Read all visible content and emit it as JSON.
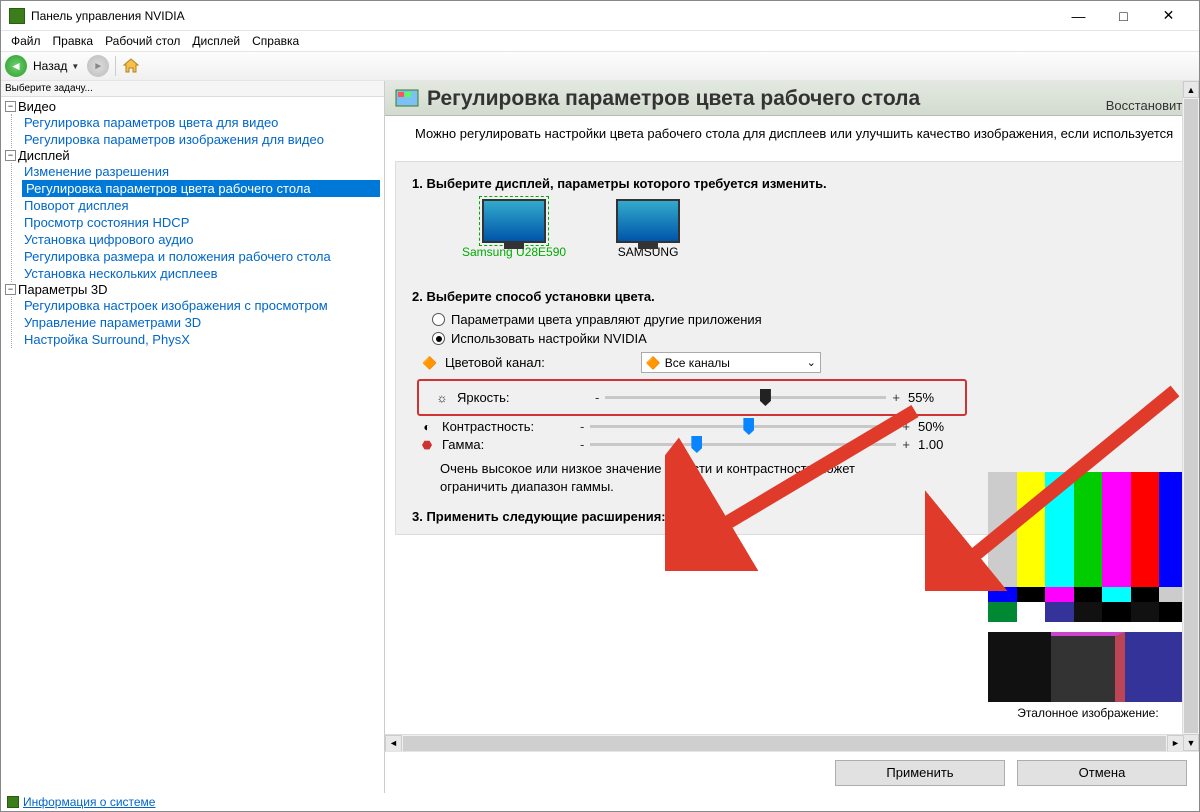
{
  "window": {
    "title": "Панель управления NVIDIA"
  },
  "menubar": [
    "Файл",
    "Правка",
    "Рабочий стол",
    "Дисплей",
    "Справка"
  ],
  "toolbar": {
    "back": "Назад"
  },
  "sidebar": {
    "task_header": "Выберите задачу...",
    "groups": [
      {
        "title": "Видео",
        "items": [
          "Регулировка параметров цвета для видео",
          "Регулировка параметров изображения для видео"
        ]
      },
      {
        "title": "Дисплей",
        "items": [
          "Изменение разрешения",
          "Регулировка параметров цвета рабочего стола",
          "Поворот дисплея",
          "Просмотр состояния HDCP",
          "Установка цифрового аудио",
          "Регулировка размера и положения рабочего стола",
          "Установка нескольких дисплеев"
        ],
        "selected": 1
      },
      {
        "title": "Параметры 3D",
        "items": [
          "Регулировка настроек изображения с просмотром",
          "Управление параметрами 3D",
          "Настройка Surround, PhysX"
        ]
      }
    ]
  },
  "page": {
    "title": "Регулировка параметров цвета рабочего стола",
    "restore": "Восстановить",
    "intro": "Можно регулировать настройки цвета рабочего стола для дисплеев или улучшить качество изображения, если используется",
    "step1": "1. Выберите дисплей, параметры которого требуется изменить.",
    "displays": [
      {
        "name": "Samsung U28E590",
        "selected": true
      },
      {
        "name": "SAMSUNG",
        "selected": false
      }
    ],
    "step2": "2. Выберите способ установки цвета.",
    "radio1": "Параметрами цвета управляют другие приложения",
    "radio2": "Использовать настройки NVIDIA",
    "channel_label": "Цветовой канал:",
    "channel_value": "Все каналы",
    "sliders": {
      "brightness": {
        "label": "Яркость:",
        "value": "55%",
        "pos": 55
      },
      "contrast": {
        "label": "Контрастность:",
        "value": "50%",
        "pos": 50
      },
      "gamma": {
        "label": "Гамма:",
        "value": "1.00",
        "pos": 33
      }
    },
    "note": "Очень высокое или низкое значение яркости и контрастности может ограничить диапазон гаммы.",
    "step3": "3. Применить следующие расширения:",
    "preview_label": "Эталонное изображение:"
  },
  "buttons": {
    "apply": "Применить",
    "cancel": "Отмена"
  },
  "footer": {
    "info": "Информация о системе"
  }
}
